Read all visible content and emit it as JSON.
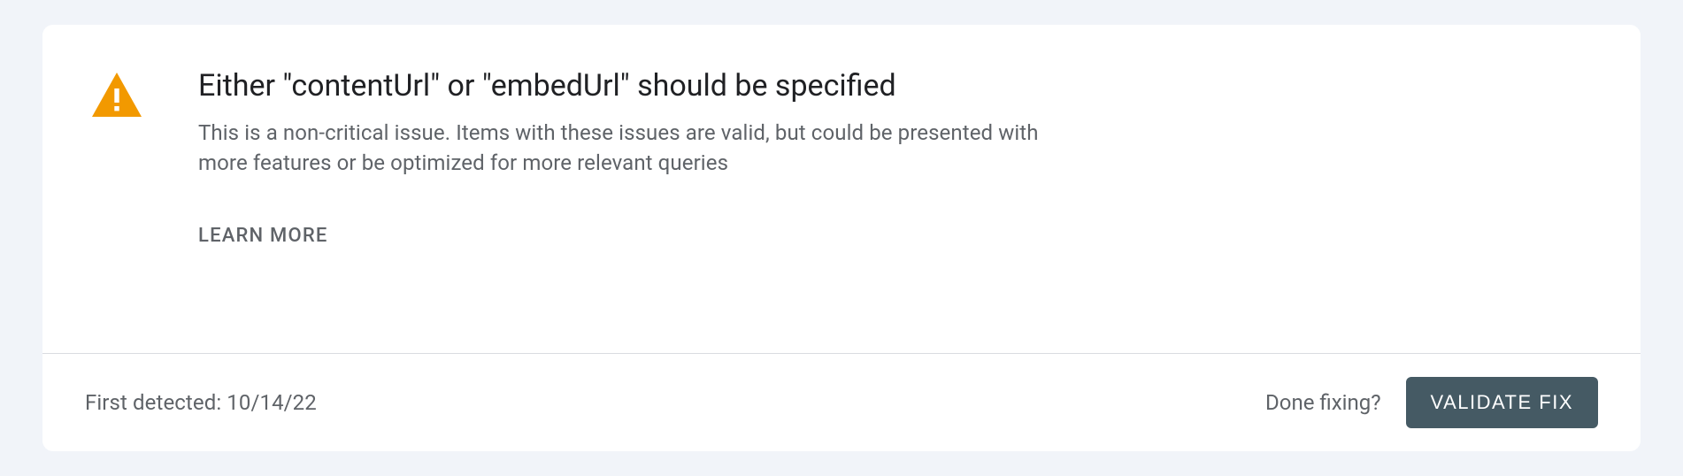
{
  "issue": {
    "title": "Either \"contentUrl\" or \"embedUrl\" should be specified",
    "description": "This is a non-critical issue. Items with these issues are valid, but could be presented with more features or be optimized for more relevant queries",
    "learn_more_label": "LEARN MORE"
  },
  "footer": {
    "first_detected_label": "First detected: 10/14/22",
    "done_fixing_label": "Done fixing?",
    "validate_button_label": "VALIDATE FIX"
  }
}
